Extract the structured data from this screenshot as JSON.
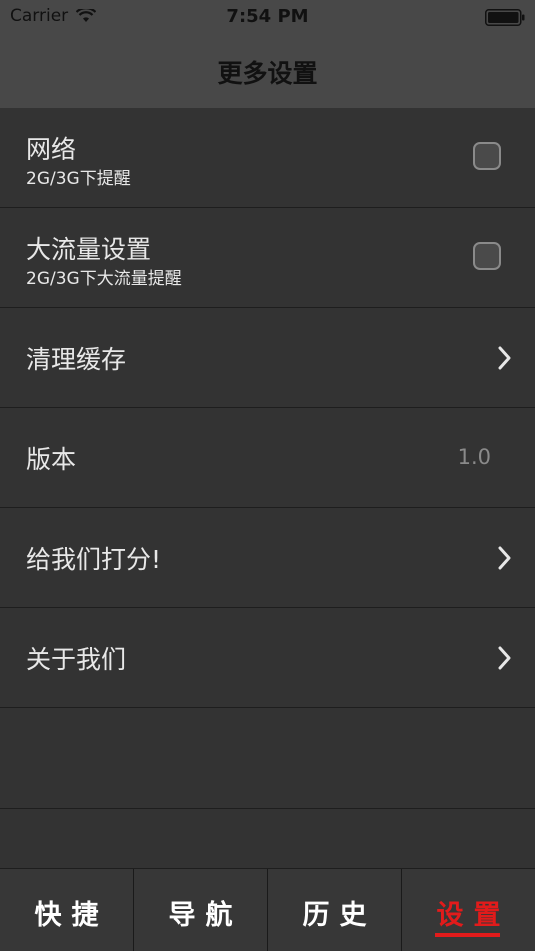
{
  "status_bar": {
    "carrier": "Carrier",
    "time": "7:54 PM"
  },
  "nav": {
    "title": "更多设置"
  },
  "settings": {
    "network": {
      "title": "网络",
      "subtitle": "2G/3G下提醒",
      "checked": false
    },
    "data_usage": {
      "title": "大流量设置",
      "subtitle": "2G/3G下大流量提醒",
      "checked": false
    },
    "clear_cache": {
      "title": "清理缓存"
    },
    "version": {
      "title": "版本",
      "value": "1.0"
    },
    "rate_us": {
      "title": "给我们打分!"
    },
    "about": {
      "title": "关于我们"
    }
  },
  "tabs": [
    {
      "label": "快捷",
      "active": false
    },
    {
      "label": "导航",
      "active": false
    },
    {
      "label": "历史",
      "active": false
    },
    {
      "label": "设置",
      "active": true
    }
  ],
  "colors": {
    "accent": "#e21b1b",
    "background": "#333333",
    "bar": "#484848"
  }
}
